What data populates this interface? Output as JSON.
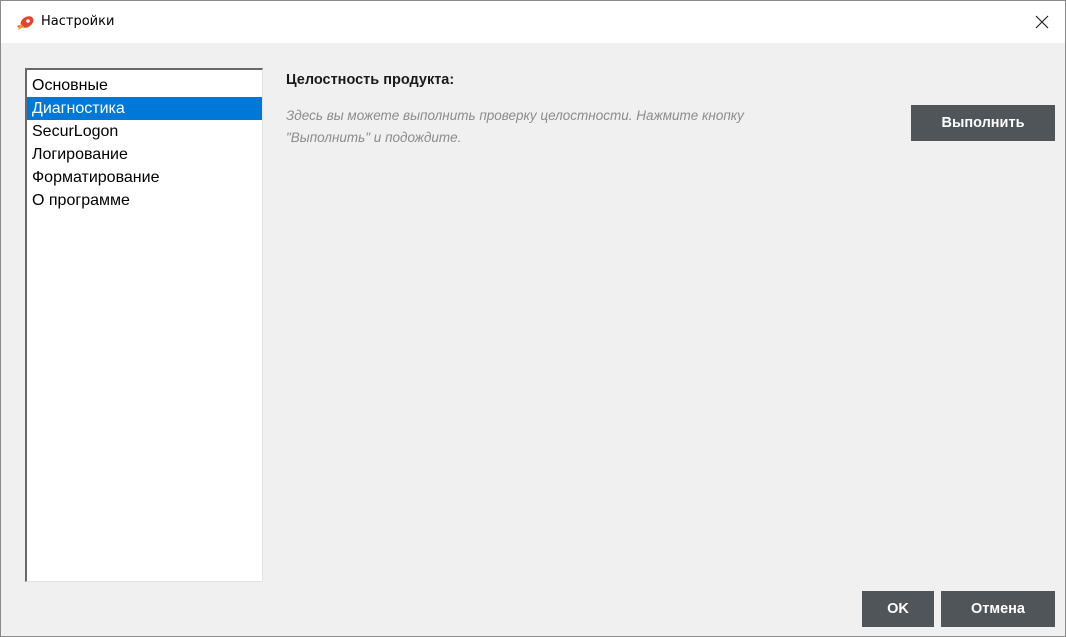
{
  "window": {
    "title": "Настройки",
    "icon": "app-rocket-icon",
    "close_icon": "close-icon"
  },
  "nav": {
    "items": [
      {
        "label": "Основные",
        "selected": false
      },
      {
        "label": "Диагностика",
        "selected": true
      },
      {
        "label": "SecurLogon",
        "selected": false
      },
      {
        "label": "Логирование",
        "selected": false
      },
      {
        "label": "Форматирование",
        "selected": false
      },
      {
        "label": "О программе",
        "selected": false
      }
    ]
  },
  "content": {
    "section_title": "Целостность продукта:",
    "description_line1": "Здесь вы можете выполнить проверку целостности. Нажмите кнопку",
    "description_line2": "\"Выполнить\" и подождите.",
    "run_label": "Выполнить"
  },
  "footer": {
    "ok_label": "OK",
    "cancel_label": "Отмена"
  },
  "colors": {
    "accent": "#0078d7",
    "button_bg": "#505559",
    "icon_red": "#e8412c"
  }
}
